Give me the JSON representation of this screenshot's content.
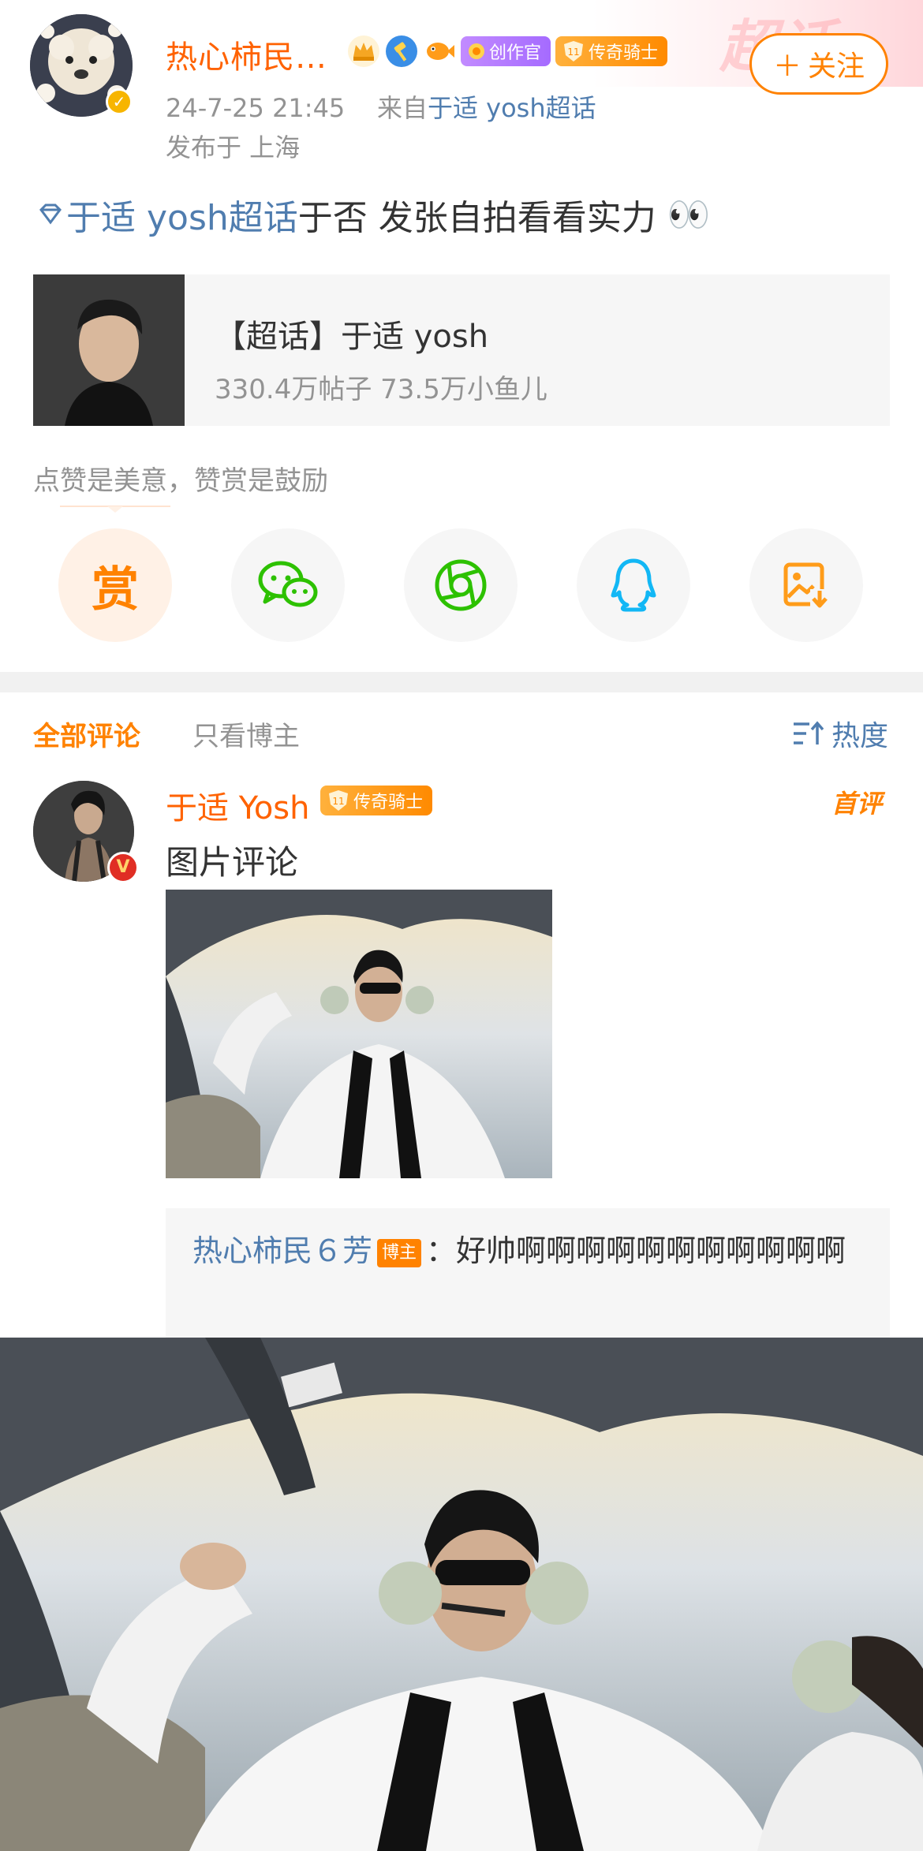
{
  "post": {
    "username": "热心柿民…",
    "timestamp": "24-7-25 21:45",
    "source_prefix": "来自",
    "source_link": "于适 yosh超话",
    "location": "发布于 上海",
    "badges": {
      "creator_label": "创作官",
      "knight_label": "传奇骑士",
      "knight_level": "11"
    },
    "follow_label": "关注",
    "follow_plus": "＋",
    "body_topic": "于适 yosh超话",
    "body_text": "于否 发张自拍看看实力",
    "body_emoji": "👀",
    "watermark_text": "超话"
  },
  "topic_card": {
    "title": "【超话】于适 yosh",
    "stats": "330.4万帖子 73.5万小鱼儿"
  },
  "reward": {
    "hint": "点赞是美意，赞赏是鼓励",
    "reward_char": "赏"
  },
  "share": {
    "icons": [
      "reward-icon",
      "wechat-icon",
      "moments-icon",
      "qq-icon",
      "save-image-icon"
    ]
  },
  "comments_tabs": {
    "all": "全部评论",
    "blogger_only": "只看博主",
    "sort_label": "热度"
  },
  "comment": {
    "author": "于适 Yosh",
    "badge_label": "传奇骑士",
    "badge_level": "11",
    "first_tag": "首评",
    "text": "图片评论",
    "reply": {
      "name": "热心柿民６芳",
      "tag": "博主",
      "text": "：好帅啊啊啊啊啊啊啊啊啊啊啊"
    }
  },
  "colors": {
    "accent": "#ff8200",
    "name_orange": "#ff6200",
    "link_blue": "#507daf",
    "muted": "#939393"
  }
}
